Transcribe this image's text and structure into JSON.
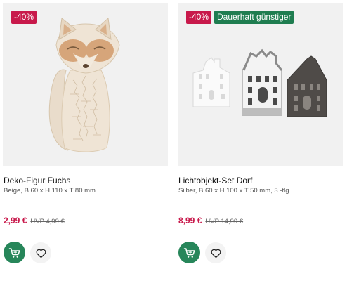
{
  "products": [
    {
      "badges": {
        "sale": "-40%"
      },
      "title": "Deko-Figur Fuchs",
      "details": "Beige, B 60 x H 110 x T 80 mm",
      "price": "2,99 €",
      "uvp": "UVP 4,99 €",
      "image": "fox-figurine"
    },
    {
      "badges": {
        "sale": "-40%",
        "deal": "Dauerhaft günstiger"
      },
      "title": "Lichtobjekt-Set Dorf",
      "details": "Silber, B 60 x H 100 x T 50 mm, 3 -tlg.",
      "price": "8,99 €",
      "uvp": "UVP 14,99 €",
      "image": "ceramic-house-lanterns"
    }
  ],
  "icons": {
    "cart": "add-to-cart-icon",
    "wishlist": "heart-icon"
  },
  "colors": {
    "sale": "#c8194b",
    "deal": "#1f7d50",
    "cart_button": "#27865a",
    "image_background": "#f1f1f1"
  }
}
